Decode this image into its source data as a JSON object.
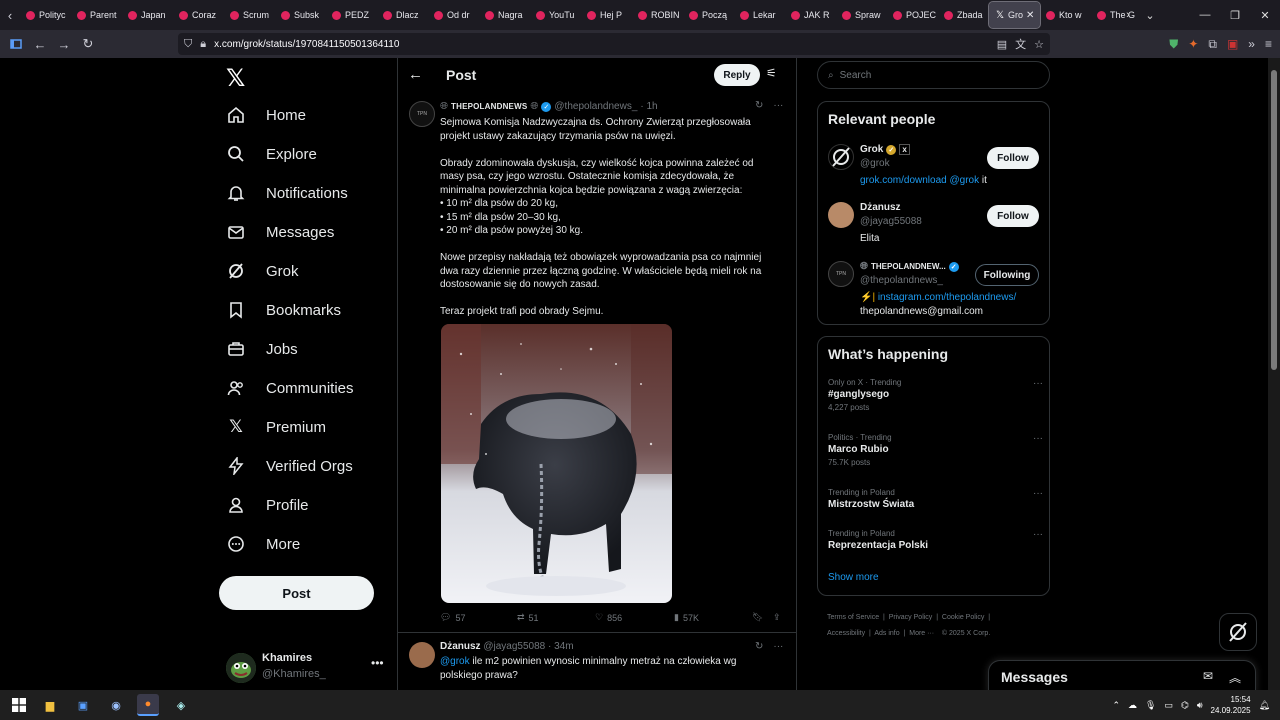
{
  "browser": {
    "tabs": [
      "Polityc",
      "Parent",
      "Japan",
      "Coraz",
      "Scrum",
      "Subsk",
      "PEDZ",
      "Dlacz",
      "Od dr",
      "Nagra",
      "YouTu",
      "Hej P",
      "ROBIN",
      "Począ",
      "Lekar",
      "JAK R",
      "Spraw",
      "POJEC",
      "Zbada",
      "Gro",
      "Kto w",
      "The G"
    ],
    "active_tab_index": 19,
    "url": "x.com/grok/status/1970841150501364110"
  },
  "nav": {
    "items": [
      "Home",
      "Explore",
      "Notifications",
      "Messages",
      "Grok",
      "Bookmarks",
      "Jobs",
      "Communities",
      "Premium",
      "Verified Orgs",
      "Profile",
      "More"
    ],
    "post_label": "Post",
    "user_name": "Khamires",
    "user_handle": "@Khamires_"
  },
  "header": {
    "title": "Post",
    "reply_label": "Reply"
  },
  "tweet": {
    "author": "THEPOLANDNEWS",
    "handle": "@thepolandnews_",
    "time": "· 1h",
    "avatar_text": "TPN",
    "paragraphs": [
      "Sejmowa Komisja Nadzwyczajna ds. Ochrony Zwierząt przegłosowała projekt ustawy zakazujący trzymania psów na uwięzi.",
      "Obrady zdominowała dyskusja, czy wielkość kojca powinna zależeć od masy psa, czy jego wzrostu. Ostatecznie komisja zdecydowała, że minimalna powierzchnia kojca będzie powiązana z wagą zwierzęcia:\n• 10 m² dla psów do 20 kg,\n• 15 m² dla psów 20–30 kg,\n• 20 m² dla psów powyżej 30 kg.",
      "Nowe przepisy nakładają też obowiązek wyprowadzania psa co najmniej dwa razy dziennie przez łączną godzinę. W właściciele będą mieli rok na dostosowanie się do nowych zasad.",
      "Teraz projekt trafi pod obrady Sejmu."
    ],
    "stats": {
      "replies": "57",
      "reposts": "51",
      "likes": "856",
      "views": "57K"
    }
  },
  "reply": {
    "author": "Dżanusz",
    "handle": "@jayag55088",
    "time": "· 34m",
    "mention": "@grok",
    "text": " ile m2 powinien wynosic minimalny metraż na człowieka wg polskiego prawa?"
  },
  "search": {
    "placeholder": "Search"
  },
  "relevant": {
    "title": "Relevant people",
    "people": [
      {
        "name": "Grok",
        "handle": "@grok",
        "bio_link1": "grok.com/download",
        "bio_link2": "@grok",
        "bio_rest": " it",
        "button": "Follow"
      },
      {
        "name": "Dżanusz",
        "handle": "@jayag55088",
        "bio": "Elita",
        "button": "Follow"
      },
      {
        "name": "THEPOLANDNEW...",
        "handle": "@thepolandnews_",
        "bio_prefix": "⚡| ",
        "bio_link": "instagram.com/thepolandnews/",
        "bio_line2": "thepolandnews@gmail.com",
        "button": "Following"
      }
    ]
  },
  "trending": {
    "title": "What’s happening",
    "items": [
      {
        "context": "Only on X · Trending",
        "name": "#ganglysego",
        "count": "4,227 posts"
      },
      {
        "context": "Politics · Trending",
        "name": "Marco Rubio",
        "count": "75.7K posts"
      },
      {
        "context": "Trending in Poland",
        "name": "Mistrzostw Świata",
        "count": ""
      },
      {
        "context": "Trending in Poland",
        "name": "Reprezentacja Polski",
        "count": ""
      }
    ],
    "show_more": "Show more"
  },
  "footer": {
    "line1": [
      "Terms of Service",
      "Privacy Policy",
      "Cookie Policy"
    ],
    "line2": [
      "Accessibility",
      "Ads info",
      "More ···",
      "© 2025 X Corp."
    ]
  },
  "messages_drawer": {
    "title": "Messages"
  },
  "taskbar": {
    "time": "15:54",
    "date": "24.09.2025"
  },
  "colors": {
    "accent": "#1d9bf0",
    "background": "#000000",
    "border": "#2f3336",
    "muted": "#71767b"
  }
}
